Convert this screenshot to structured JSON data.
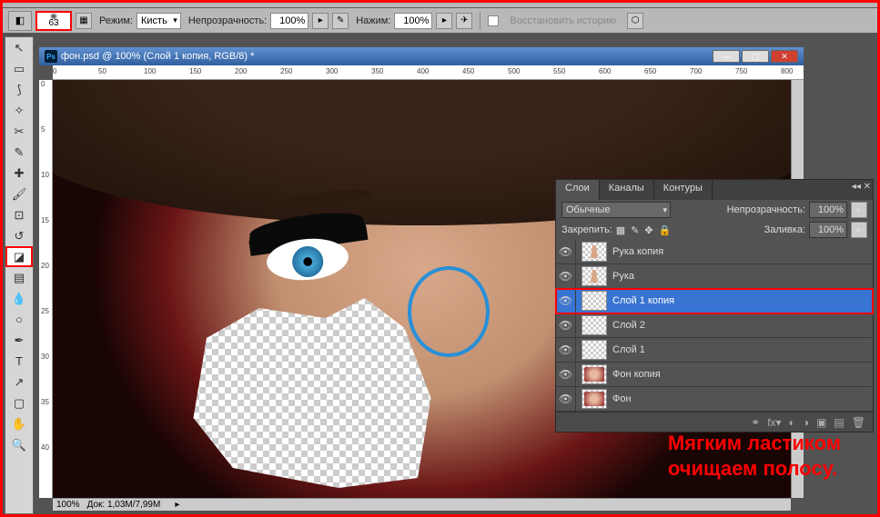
{
  "options_bar": {
    "brush_size": "63",
    "mode_label": "Режим:",
    "mode_value": "Кисть",
    "opacity_label": "Непрозрачность:",
    "opacity_value": "100%",
    "flow_label": "Нажим:",
    "flow_value": "100%",
    "restore_history": "Восстановить историю"
  },
  "document": {
    "title": "фон.psd @ 100% (Слой 1 копия, RGB/8) *",
    "zoom": "100%",
    "doc_info": "Док: 1,03M/7,99M",
    "ruler_marks": [
      "0",
      "50",
      "100",
      "150",
      "200",
      "250",
      "300",
      "350",
      "400",
      "450",
      "500",
      "550",
      "600",
      "650",
      "700",
      "750",
      "800"
    ],
    "ruler_v_marks": [
      "0",
      "5",
      "10",
      "15",
      "20",
      "25",
      "30",
      "35",
      "40"
    ]
  },
  "layers_panel": {
    "tabs": [
      "Слои",
      "Каналы",
      "Контуры"
    ],
    "blend_mode": "Обычные",
    "opacity_label": "Непрозрачность:",
    "opacity_value": "100%",
    "lock_label": "Закрепить:",
    "fill_label": "Заливка:",
    "fill_value": "100%",
    "layers": [
      {
        "name": "Рука копия",
        "thumb": "hand"
      },
      {
        "name": "Рука",
        "thumb": "hand"
      },
      {
        "name": "Слой 1 копия",
        "thumb": "checker",
        "selected": true
      },
      {
        "name": "Слой 2",
        "thumb": "checker"
      },
      {
        "name": "Слой 1",
        "thumb": "checker"
      },
      {
        "name": "Фон копия",
        "thumb": "face"
      },
      {
        "name": "Фон",
        "thumb": "face"
      }
    ]
  },
  "annotation": {
    "line1": "Мягким ластиком",
    "line2": "очищаем полосу."
  }
}
